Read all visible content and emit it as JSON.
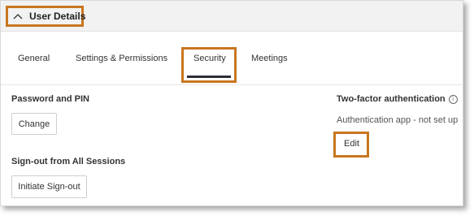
{
  "header": {
    "title": "User Details",
    "collapse_icon": "chevron-up-icon"
  },
  "tabs": [
    {
      "label": "General",
      "active": false
    },
    {
      "label": "Settings & Permissions",
      "active": false
    },
    {
      "label": "Security",
      "active": true
    },
    {
      "label": "Meetings",
      "active": false
    }
  ],
  "security": {
    "password": {
      "title": "Password and PIN",
      "button_label": "Change"
    },
    "signout": {
      "title": "Sign-out from All Sessions",
      "button_label": "Initiate Sign-out"
    },
    "two_factor": {
      "title": "Two-factor authentication",
      "info_icon": "info-icon",
      "status": "Authentication app - not set up",
      "button_label": "Edit"
    }
  },
  "colors": {
    "highlight": "#c8761f",
    "active_tab_underline": "#2b2f36",
    "header_background": "#f2f2f2"
  }
}
